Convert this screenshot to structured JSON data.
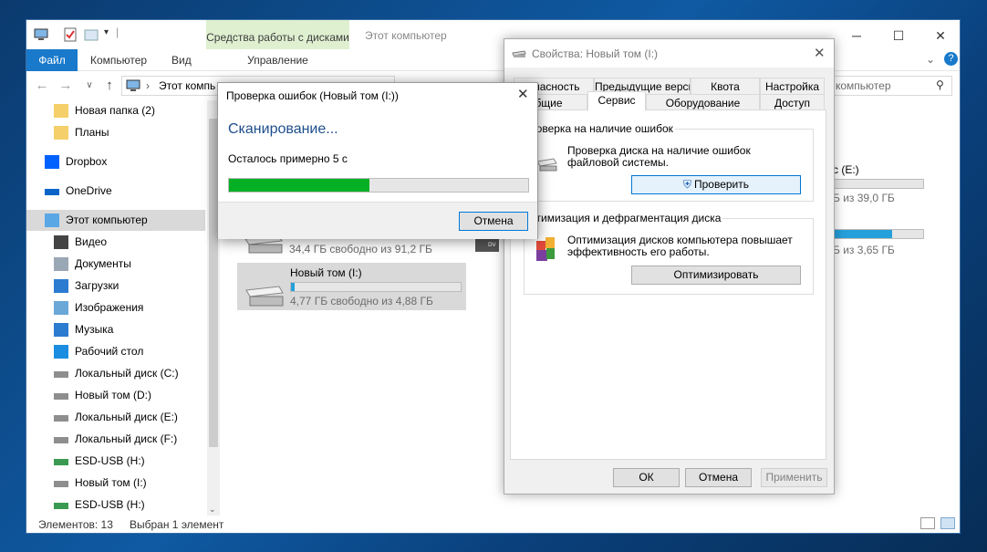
{
  "explorer": {
    "qat": [
      "computer-icon",
      "properties-icon",
      "new-folder-icon",
      "dropdown-icon"
    ],
    "tool_tab_title": "Средства работы с дисками",
    "tool_tab_sub": "Управление",
    "window_title": "Этот компьютер",
    "ribbon_tabs": {
      "file": "Файл",
      "computer": "Компьютер",
      "view": "Вид"
    },
    "address": "Этот компь",
    "search_placeholder": "компьютер",
    "nav_items": [
      {
        "label": "Новая папка (2)",
        "icon": "folder-icon"
      },
      {
        "label": "Планы",
        "icon": "folder-sync-icon"
      },
      {
        "label": "Dropbox",
        "icon": "dropbox-icon"
      },
      {
        "label": "OneDrive",
        "icon": "onedrive-icon"
      },
      {
        "label": "Этот компьютер",
        "icon": "computer-icon"
      },
      {
        "label": "Видео",
        "icon": "video-icon"
      },
      {
        "label": "Документы",
        "icon": "documents-icon"
      },
      {
        "label": "Загрузки",
        "icon": "downloads-icon"
      },
      {
        "label": "Изображения",
        "icon": "pictures-icon"
      },
      {
        "label": "Музыка",
        "icon": "music-icon"
      },
      {
        "label": "Рабочий стол",
        "icon": "desktop-icon"
      },
      {
        "label": "Локальный диск (C:)",
        "icon": "drive-icon"
      },
      {
        "label": "Новый том (D:)",
        "icon": "drive-icon"
      },
      {
        "label": "Локальный диск (E:)",
        "icon": "drive-icon"
      },
      {
        "label": "Локальный диск (F:)",
        "icon": "drive-icon"
      },
      {
        "label": "ESD-USB (H:)",
        "icon": "usb-drive-icon"
      },
      {
        "label": "Новый том (I:)",
        "icon": "drive-icon"
      },
      {
        "label": "ESD-USB (H:)",
        "icon": "usb-drive-icon"
      }
    ],
    "status_count": "Элементов: 13",
    "status_selected": "Выбран 1 элемент",
    "drives": {
      "d_free": "34,4 ГБ свободно из 91,2 ГБ",
      "i_name": "Новый том (I:)",
      "i_free": "4,77 ГБ свободно из 4,88 ГБ",
      "i_used_fraction": 0.02,
      "e_name": "с (E:)",
      "e_free": "Б из 39,0 ГБ",
      "e_used_fraction": 0.0,
      "f_free": "Б из 3,65 ГБ",
      "f_used_fraction": 0.65
    }
  },
  "props": {
    "title": "Свойства: Новый том (I:)",
    "tabs_top": [
      "опасность",
      "Предыдущие версии",
      "Квота",
      "Настройка"
    ],
    "tabs_bottom": [
      "бщие",
      "Сервис",
      "Оборудование",
      "Доступ"
    ],
    "error_group_title": "роверка на наличие ошибок",
    "error_desc": "Проверка диска на наличие ошибок файловой системы.",
    "check_button": "Проверить",
    "opt_group_title": "птимизация и дефрагментация диска",
    "opt_desc": "Оптимизация дисков компьютера повышает эффективность его работы.",
    "optimize_button": "Оптимизировать",
    "ok": "ОК",
    "cancel": "Отмена",
    "apply": "Применить"
  },
  "check": {
    "title": "Проверка ошибок (Новый том (I:))",
    "heading": "Сканирование...",
    "remaining": "Осталось примерно 5 с",
    "progress": 0.47,
    "cancel": "Отмена"
  }
}
